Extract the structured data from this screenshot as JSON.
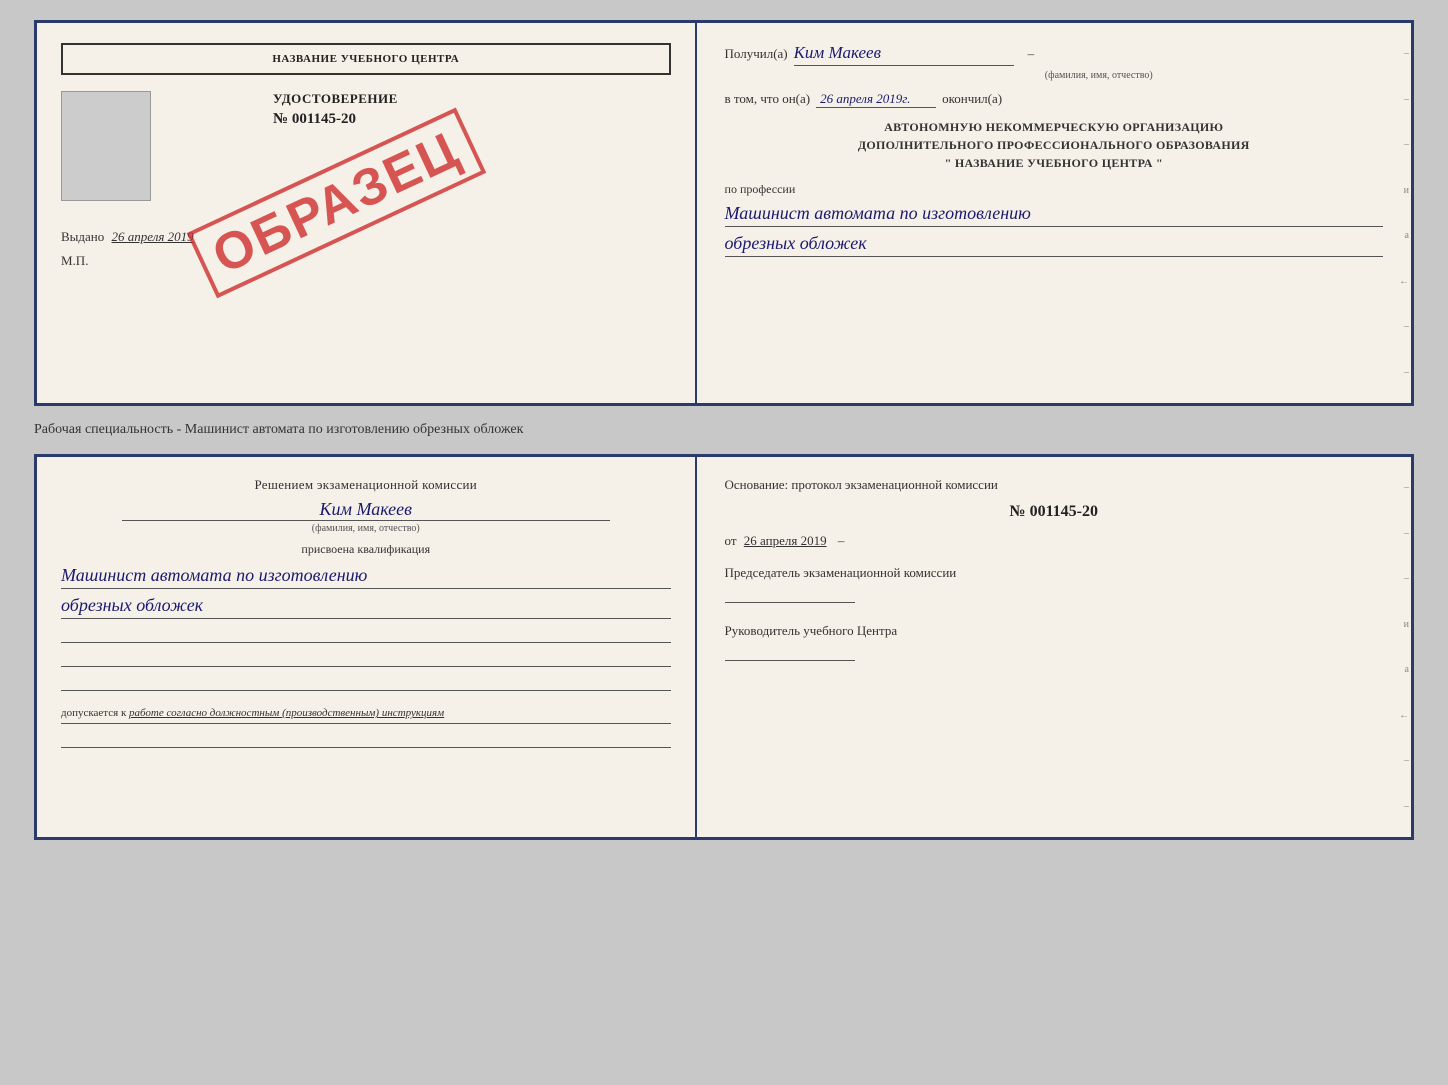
{
  "top_doc": {
    "left": {
      "school_name": "НАЗВАНИЕ УЧЕБНОГО ЦЕНТРА",
      "udostoverenie_title": "УДОСТОВЕРЕНИЕ",
      "udostoverenie_num": "№ 001145-20",
      "vydano_label": "Выдано",
      "vydano_date": "26 апреля 2019",
      "mp_label": "М.П.",
      "stamp_text": "ОБРАЗЕЦ"
    },
    "right": {
      "poluchil_label": "Получил(а)",
      "poluchil_name": "Ким Макеев",
      "fio_label": "(фамилия, имя, отчество)",
      "v_tom_label": "в том, что он(а)",
      "date_value": "26 апреля 2019г.",
      "okonchil_label": "окончил(а)",
      "org_line1": "АВТОНОМНУЮ НЕКОММЕРЧЕСКУЮ ОРГАНИЗАЦИЮ",
      "org_line2": "ДОПОЛНИТЕЛЬНОГО ПРОФЕССИОНАЛЬНОГО ОБРАЗОВАНИЯ",
      "org_line3": "\"  НАЗВАНИЕ УЧЕБНОГО ЦЕНТРА  \"",
      "po_professii_label": "по профессии",
      "profession_line1": "Машинист автомата по изготовлению",
      "profession_line2": "обрезных обложек"
    }
  },
  "middle_label": "Рабочая специальность - Машинист автомата по изготовлению обрезных обложек",
  "bottom_doc": {
    "left": {
      "resheniem_label": "Решением экзаменационной комиссии",
      "person_name": "Ким Макеев",
      "fio_label": "(фамилия, имя, отчество)",
      "prisvoena_label": "присвоена квалификация",
      "profession_line1": "Машинист автомата по изготовлению",
      "profession_line2": "обрезных обложек",
      "dopuskaetsya_label": "допускается к",
      "dopuskaetsya_text": "работе согласно должностным (производственным) инструкциям"
    },
    "right": {
      "osnovanie_label": "Основание: протокол экзаменационной комиссии",
      "protocol_num": "№ 001145-20",
      "ot_label": "от",
      "ot_date": "26 апреля 2019",
      "predsedatel_label": "Председатель экзаменационной комиссии",
      "rukovoditel_label": "Руководитель учебного Центра"
    }
  },
  "edge_labels": {
    "items": [
      "и",
      "а",
      "←",
      "–",
      "–",
      "–",
      "–",
      "–"
    ]
  }
}
